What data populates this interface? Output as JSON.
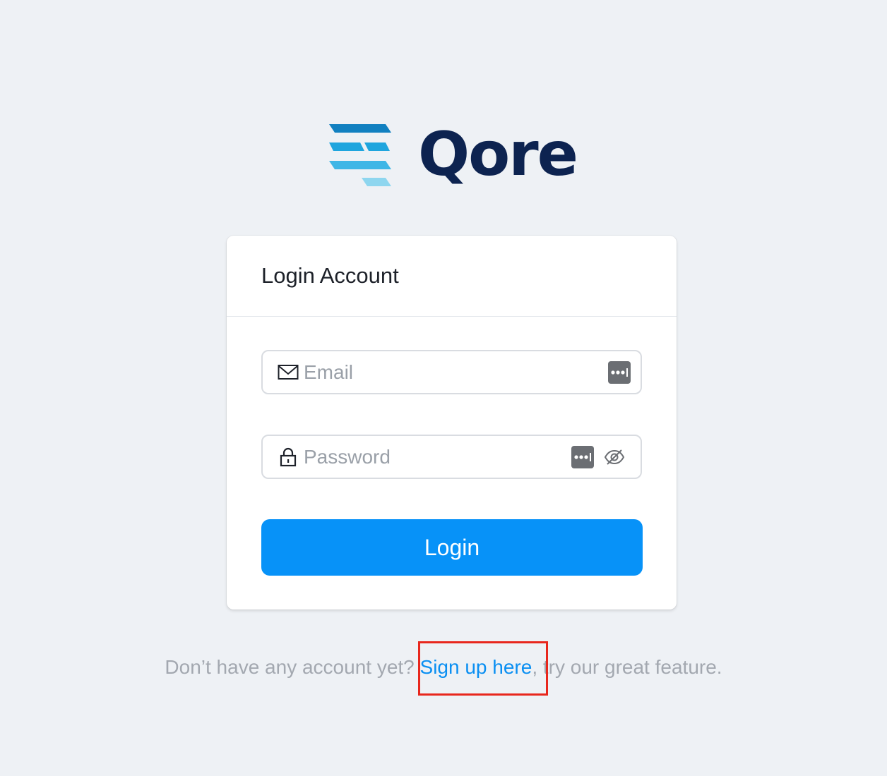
{
  "brand": {
    "name": "Qore",
    "colors": {
      "navy": "#0d2350",
      "stripe_dark": "#1180c0",
      "stripe_mid": "#1fa5de",
      "stripe_light": "#8ed6ef"
    }
  },
  "login_card": {
    "title": "Login Account",
    "email": {
      "placeholder": "Email",
      "value": "",
      "icon": "envelope-icon"
    },
    "password": {
      "placeholder": "Password",
      "value": "",
      "icon": "lock-icon",
      "toggle_icon": "eye-off-icon"
    },
    "password_manager_icon": "password-manager-icon",
    "submit_label": "Login",
    "accent_color": "#0792f8"
  },
  "signup": {
    "prefix": "Don’t have any account yet?",
    "link": "Sign up here",
    "suffix": ", try our great feature.",
    "highlight_color": "#e8271d"
  }
}
